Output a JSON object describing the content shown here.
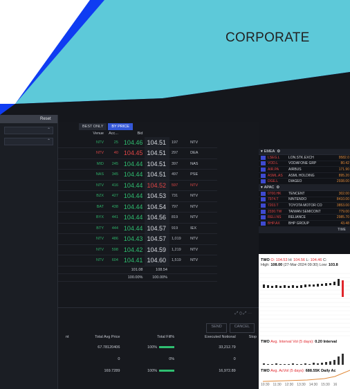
{
  "slide": {
    "title": "CORPORATE",
    "colors": {
      "teal": "#5dc9d9",
      "blue": "#0f3cf2",
      "dark": "#15171c"
    }
  },
  "left_panel": {
    "header": "Reset"
  },
  "order_book": {
    "tabs": [
      "BEST ONLY",
      "BY PRICE"
    ],
    "columns": {
      "venue": "Venue",
      "acc": "Acc...",
      "bid": "Bid"
    },
    "rows": [
      {
        "venue": "NTV",
        "acc": "25",
        "bid": "104.46",
        "ask": "104.51",
        "ask_size": "197",
        "ask_venue": "NTV",
        "bid_red": false,
        "ask_red": false
      },
      {
        "venue": "NTV",
        "acc": "40",
        "bid": "104.45",
        "ask": "104.51",
        "ask_size": "297",
        "ask_venue": "DEA",
        "bid_red": true,
        "ask_red": false
      },
      {
        "venue": "MID",
        "acc": "245",
        "bid": "104.44",
        "ask": "104.51",
        "ask_size": "397",
        "ask_venue": "NAS",
        "bid_red": false,
        "ask_red": false
      },
      {
        "venue": "NAS",
        "acc": "345",
        "bid": "104.44",
        "ask": "104.51",
        "ask_size": "497",
        "ask_venue": "PSE",
        "bid_red": false,
        "ask_red": false
      },
      {
        "venue": "NTV",
        "acc": "416",
        "bid": "104.44",
        "ask": "104.52",
        "ask_size": "597",
        "ask_venue": "NTV",
        "bid_red": false,
        "ask_red": true
      },
      {
        "venue": "BZX",
        "acc": "427",
        "bid": "104.44",
        "ask": "104.53",
        "ask_size": "731",
        "ask_venue": "NTV",
        "bid_red": false,
        "ask_red": false
      },
      {
        "venue": "BAT",
        "acc": "438",
        "bid": "104.44",
        "ask": "104.54",
        "ask_size": "797",
        "ask_venue": "NTV",
        "bid_red": false,
        "ask_red": false
      },
      {
        "venue": "BYX",
        "acc": "441",
        "bid": "104.44",
        "ask": "104.56",
        "ask_size": "819",
        "ask_venue": "NTV",
        "bid_red": false,
        "ask_red": false
      },
      {
        "venue": "BTY",
        "acc": "444",
        "bid": "104.44",
        "ask": "104.57",
        "ask_size": "919",
        "ask_venue": "IEX",
        "bid_red": false,
        "ask_red": false
      },
      {
        "venue": "NTV",
        "acc": "486",
        "bid": "104.43",
        "ask": "104.57",
        "ask_size": "1,019",
        "ask_venue": "NTV",
        "bid_red": false,
        "ask_red": false
      },
      {
        "venue": "NTV",
        "acc": "598",
        "bid": "104.42",
        "ask": "104.59",
        "ask_size": "1,219",
        "ask_venue": "NTV",
        "bid_red": false,
        "ask_red": false
      },
      {
        "venue": "NTV",
        "acc": "604",
        "bid": "104.41",
        "ask": "104.60",
        "ask_size": "1,519",
        "ask_venue": "NTV",
        "bid_red": false,
        "ask_red": false
      }
    ],
    "totals": [
      {
        "left": "101.08",
        "right": "108.54"
      },
      {
        "left": "100.00%",
        "right": "100.00%"
      }
    ]
  },
  "orders": {
    "buttons": [
      "SEND",
      "CANCEL"
    ],
    "columns": [
      "nt",
      "Total Avg Price",
      "Total Fill%",
      "Executed Notional",
      "Stop"
    ],
    "rows": [
      {
        "avg": "67.78120406",
        "fill": "100%",
        "notional": "33,212.79"
      },
      {
        "avg": "0",
        "fill": "0%",
        "notional": "0"
      },
      {
        "avg": "169.7289",
        "fill": "100%",
        "notional": "16,972.89"
      }
    ]
  },
  "watchlist": {
    "emea_label": "EMEA",
    "emea": [
      {
        "ticker": "LSEG.L",
        "name": "LON.STK.EXCH",
        "price": "9582.0"
      },
      {
        "ticker": "VOD.L",
        "name": "VODAFONE GRP",
        "price": "80.42"
      },
      {
        "ticker": "AIR.PA",
        "name": "AIRBUS",
        "price": "171.90"
      },
      {
        "ticker": "ASML.AS",
        "name": "ASML HOLDING",
        "price": "895.20"
      },
      {
        "ticker": "DGE.L",
        "name": "DIAGEO",
        "price": "2938.00"
      }
    ],
    "apac_label": "APAC",
    "apac": [
      {
        "ticker": "0700.HK",
        "name": "TENCENT",
        "price": "302.00"
      },
      {
        "ticker": "7974.T",
        "name": "NINTENDO",
        "price": "8410.00"
      },
      {
        "ticker": "7203.T",
        "name": "TOYOTA MOTOR CO",
        "price": "3853.00"
      },
      {
        "ticker": "2330.TW",
        "name": "TAIWAN SEMICONT",
        "price": "779.00"
      },
      {
        "ticker": "RELI.NS",
        "name": "RELIANCE",
        "price": "2985.70"
      },
      {
        "ticker": "BHP.AX",
        "name": "BHP GROUP",
        "price": "43.48"
      }
    ],
    "time_label": "TIME"
  },
  "chart_panel": {
    "ohlc_prefix": "TWO",
    "o_label": "O:",
    "o_value": "104.53",
    "h_label": "H:",
    "h_value": "104.56",
    "l_label": "L:",
    "l_value": "104.46",
    "c_label": "C:",
    "high_label": "High:",
    "high_value": "108.00",
    "high_date": "(27-Mar-2024 09:30)",
    "low_label": "Low:",
    "low_value": "103.8",
    "vol_prefix": "TWO",
    "vol_label": "Avg. Interval Vol (5 days):",
    "vol_value": "0.20",
    "vol_interval": "Interval",
    "acvol_prefix": "TWO",
    "acvol_label": "Avg. AcVol (5 days):",
    "acvol_value": "688.55K",
    "acvol_daily": "Daily Ac",
    "time_axis": [
      "10:30",
      "11:30",
      "12:30",
      "13:30",
      "14:30",
      "15:30",
      "16"
    ]
  }
}
